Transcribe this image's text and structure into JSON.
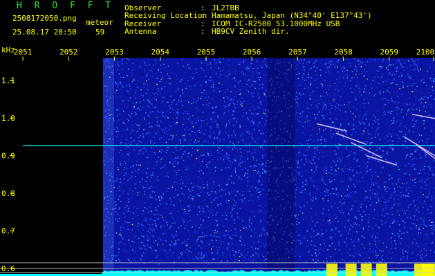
{
  "header": {
    "title": "H R O F F T",
    "filename": "2508172050.png",
    "datetime": "25.08.17 20:50",
    "meteor_label": "meteor",
    "meteor_count": "59"
  },
  "info": [
    {
      "label": "Observer",
      "value": "JL2TBB"
    },
    {
      "label": "Receiving Location",
      "value": "Hamamatsu, Japan (N34°40' E137°43')"
    },
    {
      "label": "Receiver",
      "value": "ICOM IC-R2500 53.1000MHz USB"
    },
    {
      "label": "Antenna",
      "value": "HB9CV Zenith dir."
    }
  ],
  "colors": {
    "text": "#ffff00",
    "title": "#33e033",
    "background": "#000000",
    "noise_base": "#0a14a0",
    "trace": "#00ffff",
    "meteor_line": "#e0c8ff"
  },
  "chart_data": {
    "type": "heatmap",
    "ylabel": "kHz",
    "x_ticks": [
      "2051",
      "2052",
      "2053",
      "2054",
      "2055",
      "2056",
      "2057",
      "2058",
      "2059",
      "2100"
    ],
    "y_ticks": [
      "1.1",
      "1.0",
      "0.9",
      "0.8",
      "0.7",
      "0.6"
    ],
    "xlim": [
      "20:50:30",
      "21:00:00"
    ],
    "ylim": [
      0.58,
      1.16
    ],
    "no_data_before": "20:52:45",
    "carrier_khz": 0.927,
    "meteor_echoes": [
      {
        "t": "20:57:45",
        "f_start": 0.985,
        "f_end": 0.965
      },
      {
        "t": "20:58:10",
        "f_start": 0.96,
        "f_end": 0.93
      },
      {
        "t": "20:58:30",
        "f_start": 0.935,
        "f_end": 0.895
      },
      {
        "t": "20:58:50",
        "f_start": 0.9,
        "f_end": 0.875
      },
      {
        "t": "20:59:40",
        "f_start": 0.95,
        "f_end": 0.9
      },
      {
        "t": "20:59:55",
        "f_start": 0.93,
        "f_end": 0.87
      },
      {
        "t": "20:59:50",
        "f_start": 1.01,
        "f_end": 0.995
      }
    ]
  }
}
